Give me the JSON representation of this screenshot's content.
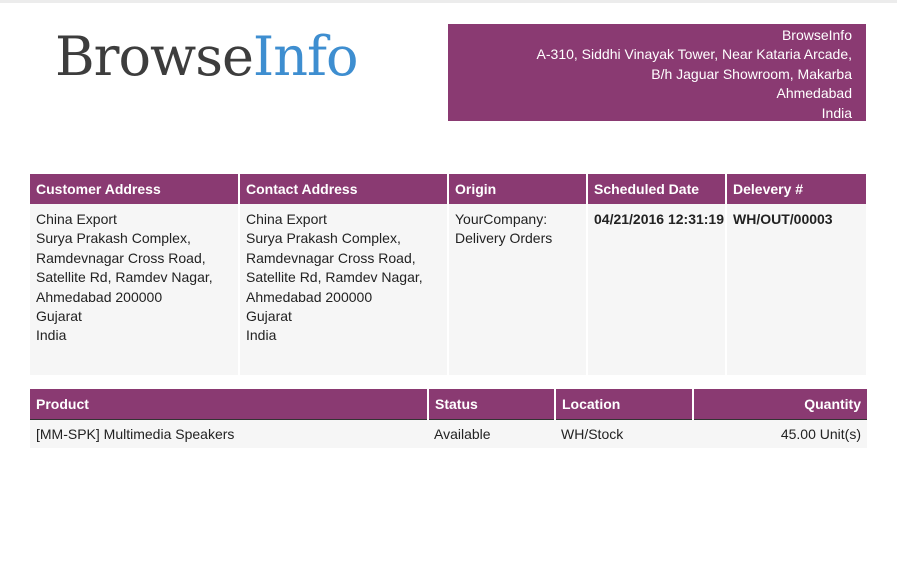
{
  "logo": {
    "part1": "Browse",
    "part2": "Info"
  },
  "company": {
    "lines": [
      "BrowseInfo",
      "A-310, Siddhi Vinayak Tower, Near Kataria Arcade,",
      "B/h Jaguar Showroom, Makarba",
      "Ahmedabad",
      "India"
    ]
  },
  "info_table": {
    "headers": [
      "Customer Address",
      "Contact Address",
      "Origin",
      "Scheduled Date",
      "Delevery #"
    ],
    "customer_address": [
      "China Export",
      "Surya Prakash Complex,",
      "Ramdevnagar Cross Road,",
      "Satellite Rd, Ramdev Nagar,",
      "Ahmedabad 200000",
      "Gujarat",
      "India"
    ],
    "contact_address": [
      "China Export",
      "Surya Prakash Complex,",
      "Ramdevnagar Cross Road,",
      "Satellite Rd, Ramdev Nagar,",
      "Ahmedabad 200000",
      "Gujarat",
      "India"
    ],
    "origin": [
      "YourCompany:",
      "Delivery Orders"
    ],
    "scheduled_date": "04/21/2016 12:31:19",
    "delivery_number": "WH/OUT/00003"
  },
  "product_table": {
    "headers": [
      "Product",
      "Status",
      "Location",
      "Quantity"
    ],
    "rows": [
      {
        "product": "[MM-SPK] Multimedia Speakers",
        "status": "Available",
        "location": "WH/Stock",
        "quantity": "45.00 Unit(s)"
      }
    ]
  },
  "colors": {
    "accent": "#8a3a72",
    "logo_blue": "#3e8ed0",
    "logo_dark": "#3d3d3d",
    "cell_bg": "#f6f6f6"
  }
}
